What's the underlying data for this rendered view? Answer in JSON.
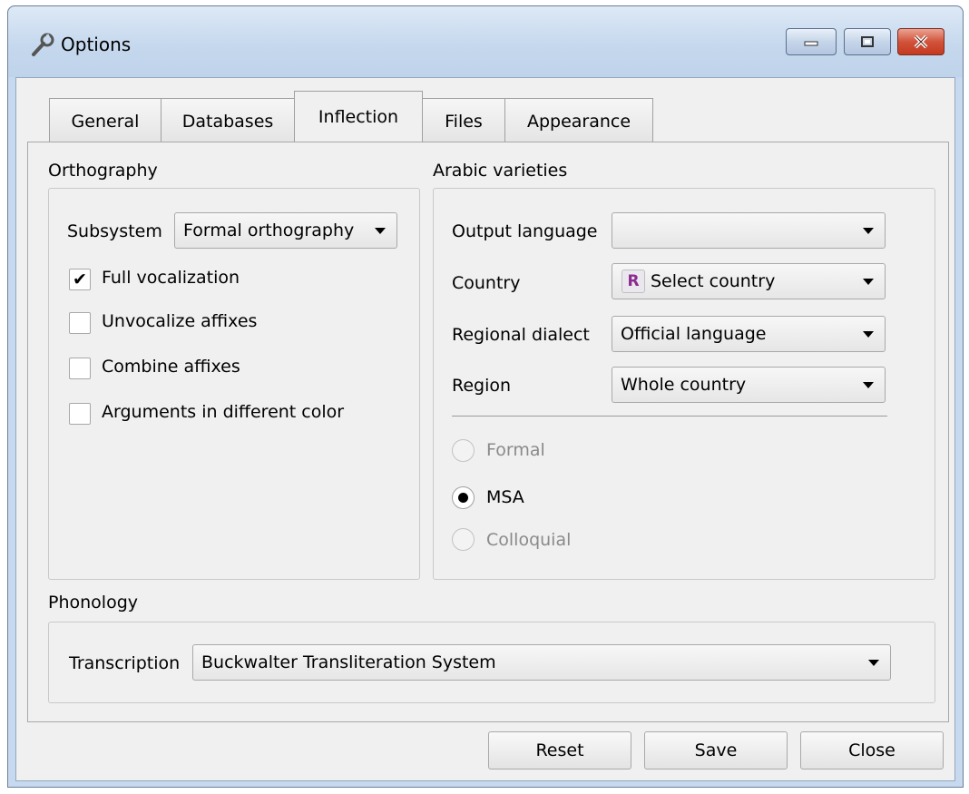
{
  "window": {
    "title": "Options"
  },
  "tabs": [
    {
      "label": "General",
      "active": false
    },
    {
      "label": "Databases",
      "active": false
    },
    {
      "label": "Inflection",
      "active": true
    },
    {
      "label": "Files",
      "active": false
    },
    {
      "label": "Appearance",
      "active": false
    }
  ],
  "orthography": {
    "heading": "Orthography",
    "subsystem_label": "Subsystem",
    "subsystem_value": "Formal orthography",
    "checkboxes": [
      {
        "label": "Full vocalization",
        "checked": true
      },
      {
        "label": "Unvocalize affixes",
        "checked": false
      },
      {
        "label": "Combine affixes",
        "checked": false
      },
      {
        "label": "Arguments in different color",
        "checked": false
      }
    ]
  },
  "varieties": {
    "heading": "Arabic varieties",
    "output_language_label": "Output language",
    "output_language_value": "",
    "country_label": "Country",
    "country_badge": "R",
    "country_value": "Select country",
    "regional_dialect_label": "Regional dialect",
    "regional_dialect_value": "Official language",
    "region_label": "Region",
    "region_value": "Whole country",
    "radios": [
      {
        "label": "Formal",
        "selected": false,
        "enabled": false
      },
      {
        "label": "MSA",
        "selected": true,
        "enabled": true
      },
      {
        "label": "Colloquial",
        "selected": false,
        "enabled": false
      }
    ]
  },
  "phonology": {
    "heading": "Phonology",
    "transcription_label": "Transcription",
    "transcription_value": "Buckwalter Transliteration System"
  },
  "buttons": {
    "reset": "Reset",
    "save": "Save",
    "close": "Close"
  },
  "icons": {
    "title": "wrench-icon",
    "minimize": "minimize-icon",
    "maximize": "maximize-icon",
    "close": "close-icon"
  },
  "colors": {
    "close_button": "#c4391f",
    "badge_text": "#8a2c8f"
  }
}
